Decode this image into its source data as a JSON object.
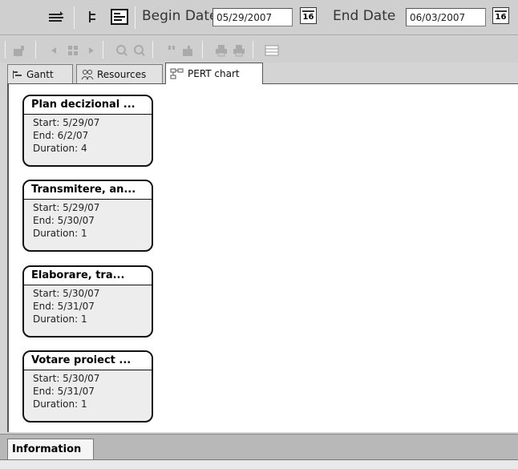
{
  "toolbar": {
    "begin_label": "Begin Date",
    "begin_value": "05/29/2007",
    "end_label": "End Date",
    "end_value": "06/03/2007",
    "calendar_label": "16"
  },
  "tabs": [
    {
      "label": "Gantt",
      "icon": "gantt-icon"
    },
    {
      "label": "Resources",
      "icon": "resources-icon"
    },
    {
      "label": "PERT chart",
      "icon": "pert-chart-icon",
      "active": true
    }
  ],
  "nodes": [
    {
      "title": "Plan decizional ...",
      "start": "Start: 5/29/07",
      "end": "End: 6/2/07",
      "duration": "Duration: 4"
    },
    {
      "title": "Transmitere, an...",
      "start": "Start: 5/29/07",
      "end": "End: 5/30/07",
      "duration": "Duration: 1"
    },
    {
      "title": "Elaborare, tra...",
      "start": "Start: 5/30/07",
      "end": "End: 5/31/07",
      "duration": "Duration: 1"
    },
    {
      "title": "Votare proiect ...",
      "start": "Start: 5/30/07",
      "end": "End: 5/31/07",
      "duration": "Duration: 1"
    }
  ],
  "info": {
    "tab_label": "Information"
  }
}
